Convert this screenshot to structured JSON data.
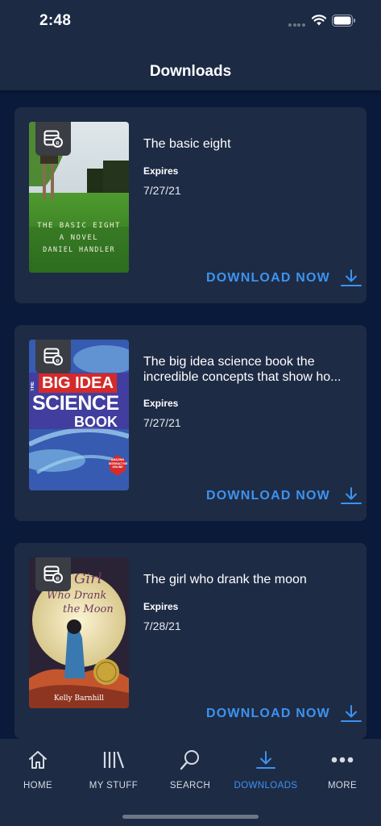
{
  "status": {
    "time": "2:48"
  },
  "header": {
    "title": "Downloads"
  },
  "books": [
    {
      "title": "The basic eight",
      "expires_label": "Expires",
      "expires_date": "7/27/21",
      "download_label": "DOWNLOAD NOW",
      "cover": {
        "line1": "THE BASIC EIGHT",
        "line2": "A NOVEL",
        "line3": "DANIEL HANDLER"
      }
    },
    {
      "title": "The big idea science book the incredible concepts that show ho...",
      "expires_label": "Expires",
      "expires_date": "7/27/21",
      "download_label": "DOWNLOAD NOW",
      "cover": {
        "line1": "THE",
        "line2": "BIG IDEA",
        "line3": "SCIENCE",
        "line4": "BOOK",
        "badge": "AMAZING INTERACTIVE ONLINE"
      }
    },
    {
      "title": "The girl who drank the moon",
      "expires_label": "Expires",
      "expires_date": "7/28/21",
      "download_label": "DOWNLOAD NOW",
      "cover": {
        "line1": "Girl",
        "line2": "Who Drank",
        "line3": "the Moon",
        "author": "Kelly Barnhill"
      }
    }
  ],
  "tabs": [
    {
      "label": "HOME",
      "icon": "home-icon"
    },
    {
      "label": "MY STUFF",
      "icon": "library-icon"
    },
    {
      "label": "SEARCH",
      "icon": "search-icon"
    },
    {
      "label": "DOWNLOADS",
      "icon": "download-icon",
      "active": true
    },
    {
      "label": "MORE",
      "icon": "more-icon"
    }
  ],
  "colors": {
    "accent": "#3c93f0",
    "background": "#091a3a",
    "card": "#1e2b45",
    "bar": "#1c2a43"
  }
}
